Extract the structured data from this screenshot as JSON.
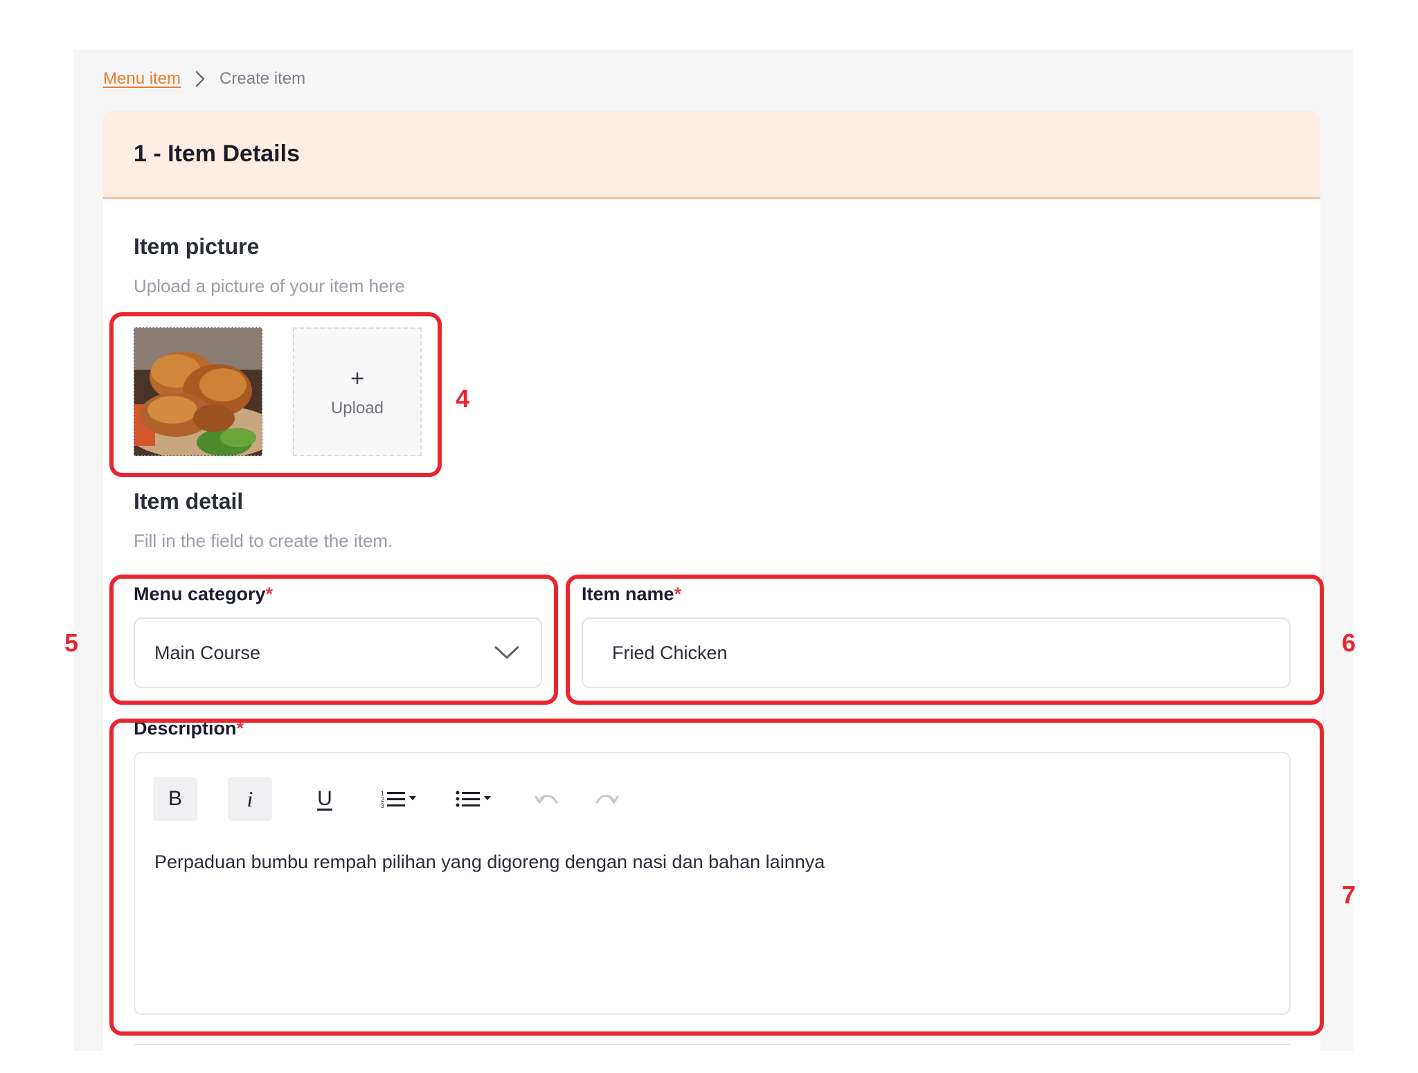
{
  "breadcrumb": {
    "parent": "Menu item",
    "current": "Create item"
  },
  "section": {
    "title": "1 - Item Details"
  },
  "item_picture": {
    "title": "Item picture",
    "subtitle": "Upload a picture of your item here",
    "upload_label": "Upload",
    "upload_plus": "+"
  },
  "item_detail": {
    "title": "Item detail",
    "subtitle": "Fill in the field to create the item."
  },
  "fields": {
    "menu_category": {
      "label": "Menu category",
      "required_mark": "*",
      "value": "Main Course"
    },
    "item_name": {
      "label": "Item name",
      "required_mark": "*",
      "value": "Fried Chicken"
    },
    "description": {
      "label": "Description",
      "required_mark": "*",
      "value": "Perpaduan bumbu rempah pilihan yang digoreng dengan nasi dan bahan lainnya"
    }
  },
  "toolbar": {
    "bold": "B",
    "italic": "i",
    "underline": "U",
    "icons": [
      "bold-icon",
      "italic-icon",
      "underline-icon",
      "ordered-list-icon",
      "bullet-list-icon",
      "undo-icon",
      "redo-icon"
    ]
  },
  "annotations": [
    "4",
    "5",
    "6",
    "7"
  ],
  "colors": {
    "accent": "#ef7a2a",
    "header_bg": "#fdeee3",
    "annotation": "#e8262f",
    "required": "#e63a3a"
  }
}
